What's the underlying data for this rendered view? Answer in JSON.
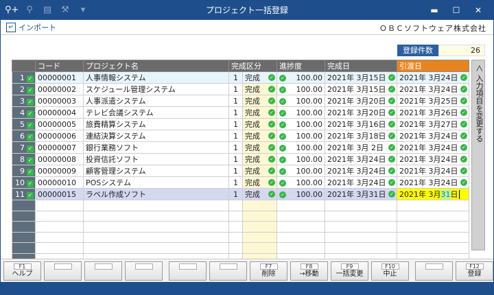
{
  "window": {
    "title": "プロジェクト一括登録",
    "min": "▬",
    "max": "☐",
    "close": "✕"
  },
  "toolbar": {
    "import_label": "インポート",
    "company": "ＯＢＣソフトウェア株式会社"
  },
  "count": {
    "label": "登録件数",
    "value": "26"
  },
  "columns": {
    "code": "コード",
    "name": "プロジェクト名",
    "kubun": "完成区分",
    "progress": "進捗度",
    "done_date": "完成日",
    "hand_date": "引渡日"
  },
  "rows": [
    {
      "no": "1",
      "code": "00000001",
      "name": "人事情報システム",
      "kc": "1",
      "kn": "完成",
      "progress": "100.00",
      "done": "2021年 3月15日",
      "hand": "2021年 3月24日"
    },
    {
      "no": "2",
      "code": "00000002",
      "name": "スケジュール管理システム",
      "kc": "1",
      "kn": "完成",
      "progress": "100.00",
      "done": "2021年 3月15日",
      "hand": "2021年 3月24日"
    },
    {
      "no": "3",
      "code": "00000003",
      "name": "人事派遣システム",
      "kc": "1",
      "kn": "完成",
      "progress": "100.00",
      "done": "2021年 3月20日",
      "hand": "2021年 3月25日"
    },
    {
      "no": "4",
      "code": "00000004",
      "name": "テレビ会議システム",
      "kc": "1",
      "kn": "完成",
      "progress": "100.00",
      "done": "2021年 3月20日",
      "hand": "2021年 3月26日"
    },
    {
      "no": "5",
      "code": "00000005",
      "name": "旅費精算システム",
      "kc": "1",
      "kn": "完成",
      "progress": "100.00",
      "done": "2021年 3月16日",
      "hand": "2021年 3月27日"
    },
    {
      "no": "6",
      "code": "00000006",
      "name": "連結決算システム",
      "kc": "1",
      "kn": "完成",
      "progress": "100.00",
      "done": "2021年 3月18日",
      "hand": "2021年 3月24日"
    },
    {
      "no": "7",
      "code": "00000007",
      "name": "銀行業務ソフト",
      "kc": "1",
      "kn": "完成",
      "progress": "100.00",
      "done": "2021年 3月 2日",
      "hand": "2021年 3月24日"
    },
    {
      "no": "8",
      "code": "00000008",
      "name": "投資信託ソフト",
      "kc": "1",
      "kn": "完成",
      "progress": "100.00",
      "done": "2021年 3月24日",
      "hand": "2021年 3月24日"
    },
    {
      "no": "9",
      "code": "00000009",
      "name": "顧客管理システム",
      "kc": "1",
      "kn": "完成",
      "progress": "100.00",
      "done": "2021年 3月24日",
      "hand": "2021年 3月24日"
    },
    {
      "no": "10",
      "code": "00000010",
      "name": "POSシステム",
      "kc": "1",
      "kn": "完成",
      "progress": "100.00",
      "done": "2021年 3月24日",
      "hand": "2021年 3月24日"
    },
    {
      "no": "11",
      "code": "00000015",
      "name": "ラベル作成ソフト",
      "kc": "1",
      "kn": "完成",
      "progress": "100.00",
      "done": "2021年 3月31日",
      "hand_a": "2021年 3月",
      "hand_b": "31",
      "hand_c": "日"
    }
  ],
  "side": {
    "label": "＜ 入力項目を変更する"
  },
  "fkeys": [
    {
      "fn": "F1",
      "label": "ヘルプ"
    },
    {
      "fn": "",
      "label": ""
    },
    {
      "fn": "",
      "label": ""
    },
    {
      "fn": "",
      "label": ""
    },
    {
      "fn": "",
      "label": ""
    },
    {
      "fn": "",
      "label": ""
    },
    {
      "fn": "F7",
      "label": "削除"
    },
    {
      "fn": "F8",
      "label": "→移動"
    },
    {
      "fn": "F9",
      "label": "一括変更"
    },
    {
      "fn": "F10",
      "label": "中止"
    },
    {
      "fn": "",
      "label": ""
    },
    {
      "fn": "F12",
      "label": "登録"
    }
  ],
  "icons": [
    "search-icon",
    "preview-icon",
    "print-icon",
    "settings-icon",
    "dropdown-icon"
  ]
}
